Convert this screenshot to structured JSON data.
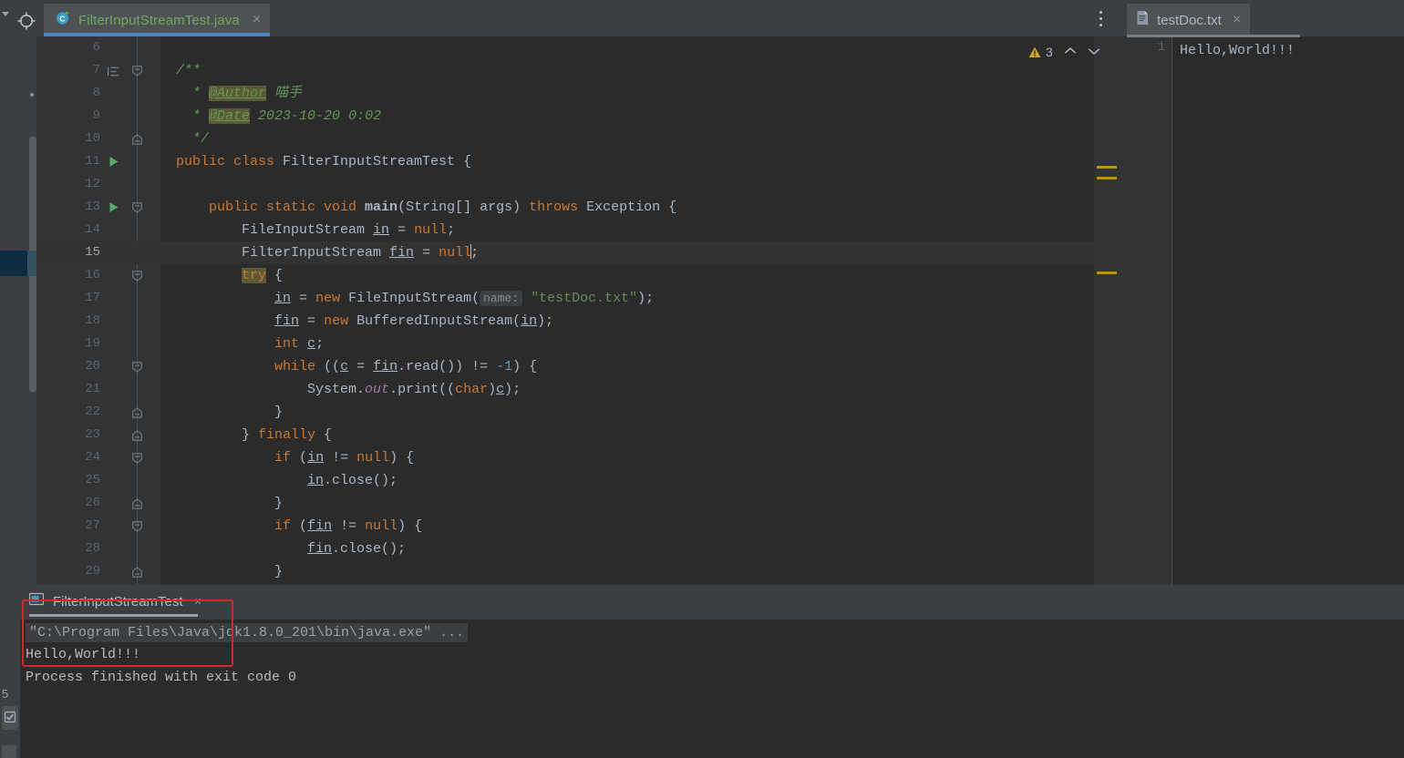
{
  "app": {
    "theme_bg": "#3C3F41",
    "editor_bg": "#2B2B2B",
    "accent": "#4A88C7"
  },
  "left_toolbar": {
    "locate_icon": "crosshair-locate-icon",
    "collapse_icon": "chevron-down-icon"
  },
  "editor_tabs": {
    "active": {
      "label": "FilterInputStreamTest.java",
      "icon": "java-class-icon",
      "close": "×"
    },
    "kebab_icon": "more-vertical-icon"
  },
  "inspections": {
    "icon": "warning-triangle-icon",
    "count": "3",
    "prev_icon": "chevron-up-icon",
    "next_icon": "chevron-down-icon"
  },
  "code": {
    "lines": [
      {
        "n": "6",
        "fold": "",
        "run": false,
        "current": false,
        "html": ""
      },
      {
        "n": "7",
        "fold": "open",
        "run": false,
        "current": false,
        "indent_icon": true,
        "html": "<span class=\"cmt\">/**</span>"
      },
      {
        "n": "8",
        "fold": "",
        "run": false,
        "current": false,
        "html": "  <span class=\"cmt\">* </span><span class=\"tag\">@Author</span><span class=\"cmt\"> 喵手</span>"
      },
      {
        "n": "9",
        "fold": "",
        "run": false,
        "current": false,
        "html": "  <span class=\"cmt\">* </span><span class=\"tag\">@Date</span><span class=\"cmt\"> 2023-10-20 0:02</span>"
      },
      {
        "n": "10",
        "fold": "end",
        "run": false,
        "current": false,
        "html": "  <span class=\"cmt\">*/</span>"
      },
      {
        "n": "11",
        "fold": "",
        "run": true,
        "current": false,
        "html": "<span class=\"kw\">public class </span>FilterInputStreamTest {"
      },
      {
        "n": "12",
        "fold": "",
        "run": false,
        "current": false,
        "html": ""
      },
      {
        "n": "13",
        "fold": "open",
        "run": true,
        "current": false,
        "html": "    <span class=\"kw\">public static void </span><span class=\"fn\">main</span>(String[] args) <span class=\"kw\">throws </span>Exception {"
      },
      {
        "n": "14",
        "fold": "",
        "run": false,
        "current": false,
        "html": "        FileInputStream <span class=\"var\">in</span> = <span class=\"kw\">null</span>;"
      },
      {
        "n": "15",
        "fold": "",
        "run": false,
        "current": true,
        "html": "        FilterInputStream <span class=\"var\">fin</span> = <span class=\"kw\">null</span><span class=\"caret\"></span>;"
      },
      {
        "n": "16",
        "fold": "open",
        "run": false,
        "current": false,
        "html": "        <span class=\"trykw\">try</span> {"
      },
      {
        "n": "17",
        "fold": "",
        "run": false,
        "current": false,
        "html": "            <span class=\"var\">in</span> = <span class=\"kw\">new </span>FileInputStream(<span class=\"hint\">name:</span> <span class=\"str\">\"testDoc.txt\"</span>);"
      },
      {
        "n": "18",
        "fold": "",
        "run": false,
        "current": false,
        "html": "            <span class=\"var\">fin</span> = <span class=\"kw\">new </span>BufferedInputStream(<span class=\"var\">in</span>);"
      },
      {
        "n": "19",
        "fold": "",
        "run": false,
        "current": false,
        "html": "            <span class=\"kw\">int </span><span class=\"var\">c</span>;"
      },
      {
        "n": "20",
        "fold": "open",
        "run": false,
        "current": false,
        "html": "            <span class=\"kw\">while </span>((<span class=\"var\">c</span> = <span class=\"var\">fin</span>.read()) != <span class=\"num\">-1</span>) {"
      },
      {
        "n": "21",
        "fold": "",
        "run": false,
        "current": false,
        "html": "                System.<span class=\"fld\">out</span>.print((<span class=\"kw\">char</span>)<span class=\"var\">c</span>);"
      },
      {
        "n": "22",
        "fold": "end",
        "run": false,
        "current": false,
        "html": "            }"
      },
      {
        "n": "23",
        "fold": "end",
        "run": false,
        "current": false,
        "html": "        } <span class=\"kw\">finally </span>{"
      },
      {
        "n": "24",
        "fold": "open",
        "run": false,
        "current": false,
        "html": "            <span class=\"kw\">if </span>(<span class=\"var\">in</span> != <span class=\"kw\">null</span>) {"
      },
      {
        "n": "25",
        "fold": "",
        "run": false,
        "current": false,
        "html": "                <span class=\"var\">in</span>.close();"
      },
      {
        "n": "26",
        "fold": "end",
        "run": false,
        "current": false,
        "html": "            }"
      },
      {
        "n": "27",
        "fold": "open",
        "run": false,
        "current": false,
        "html": "            <span class=\"kw\">if </span>(<span class=\"var\">fin</span> != <span class=\"kw\">null</span>) {"
      },
      {
        "n": "28",
        "fold": "",
        "run": false,
        "current": false,
        "html": "                <span class=\"var\">fin</span>.close();"
      },
      {
        "n": "29",
        "fold": "end",
        "run": false,
        "current": false,
        "html": "            }"
      }
    ]
  },
  "right_pane": {
    "tab": {
      "label": "testDoc.txt",
      "icon": "text-file-icon",
      "close": "×"
    },
    "line_number": "1",
    "content": "Hello,World!!!"
  },
  "run_panel": {
    "tab": {
      "label": "FilterInputStreamTest",
      "icon": "run-console-icon",
      "close": "×"
    },
    "output": [
      {
        "text": "\"C:\\Program Files\\Java\\jdk1.8.0_201\\bin\\java.exe\" ...",
        "folded": true
      },
      {
        "text": "Hello,World!!!",
        "folded": false
      },
      {
        "text": "Process finished with exit code 0",
        "folded": false
      }
    ]
  },
  "annotation": {
    "color": "#CC2B2B",
    "label": "output-highlight-box"
  },
  "left_bottom_bar": {
    "count": "5",
    "toggle_icon": "checkbox-icon",
    "panel_icon": "panel-icon"
  }
}
